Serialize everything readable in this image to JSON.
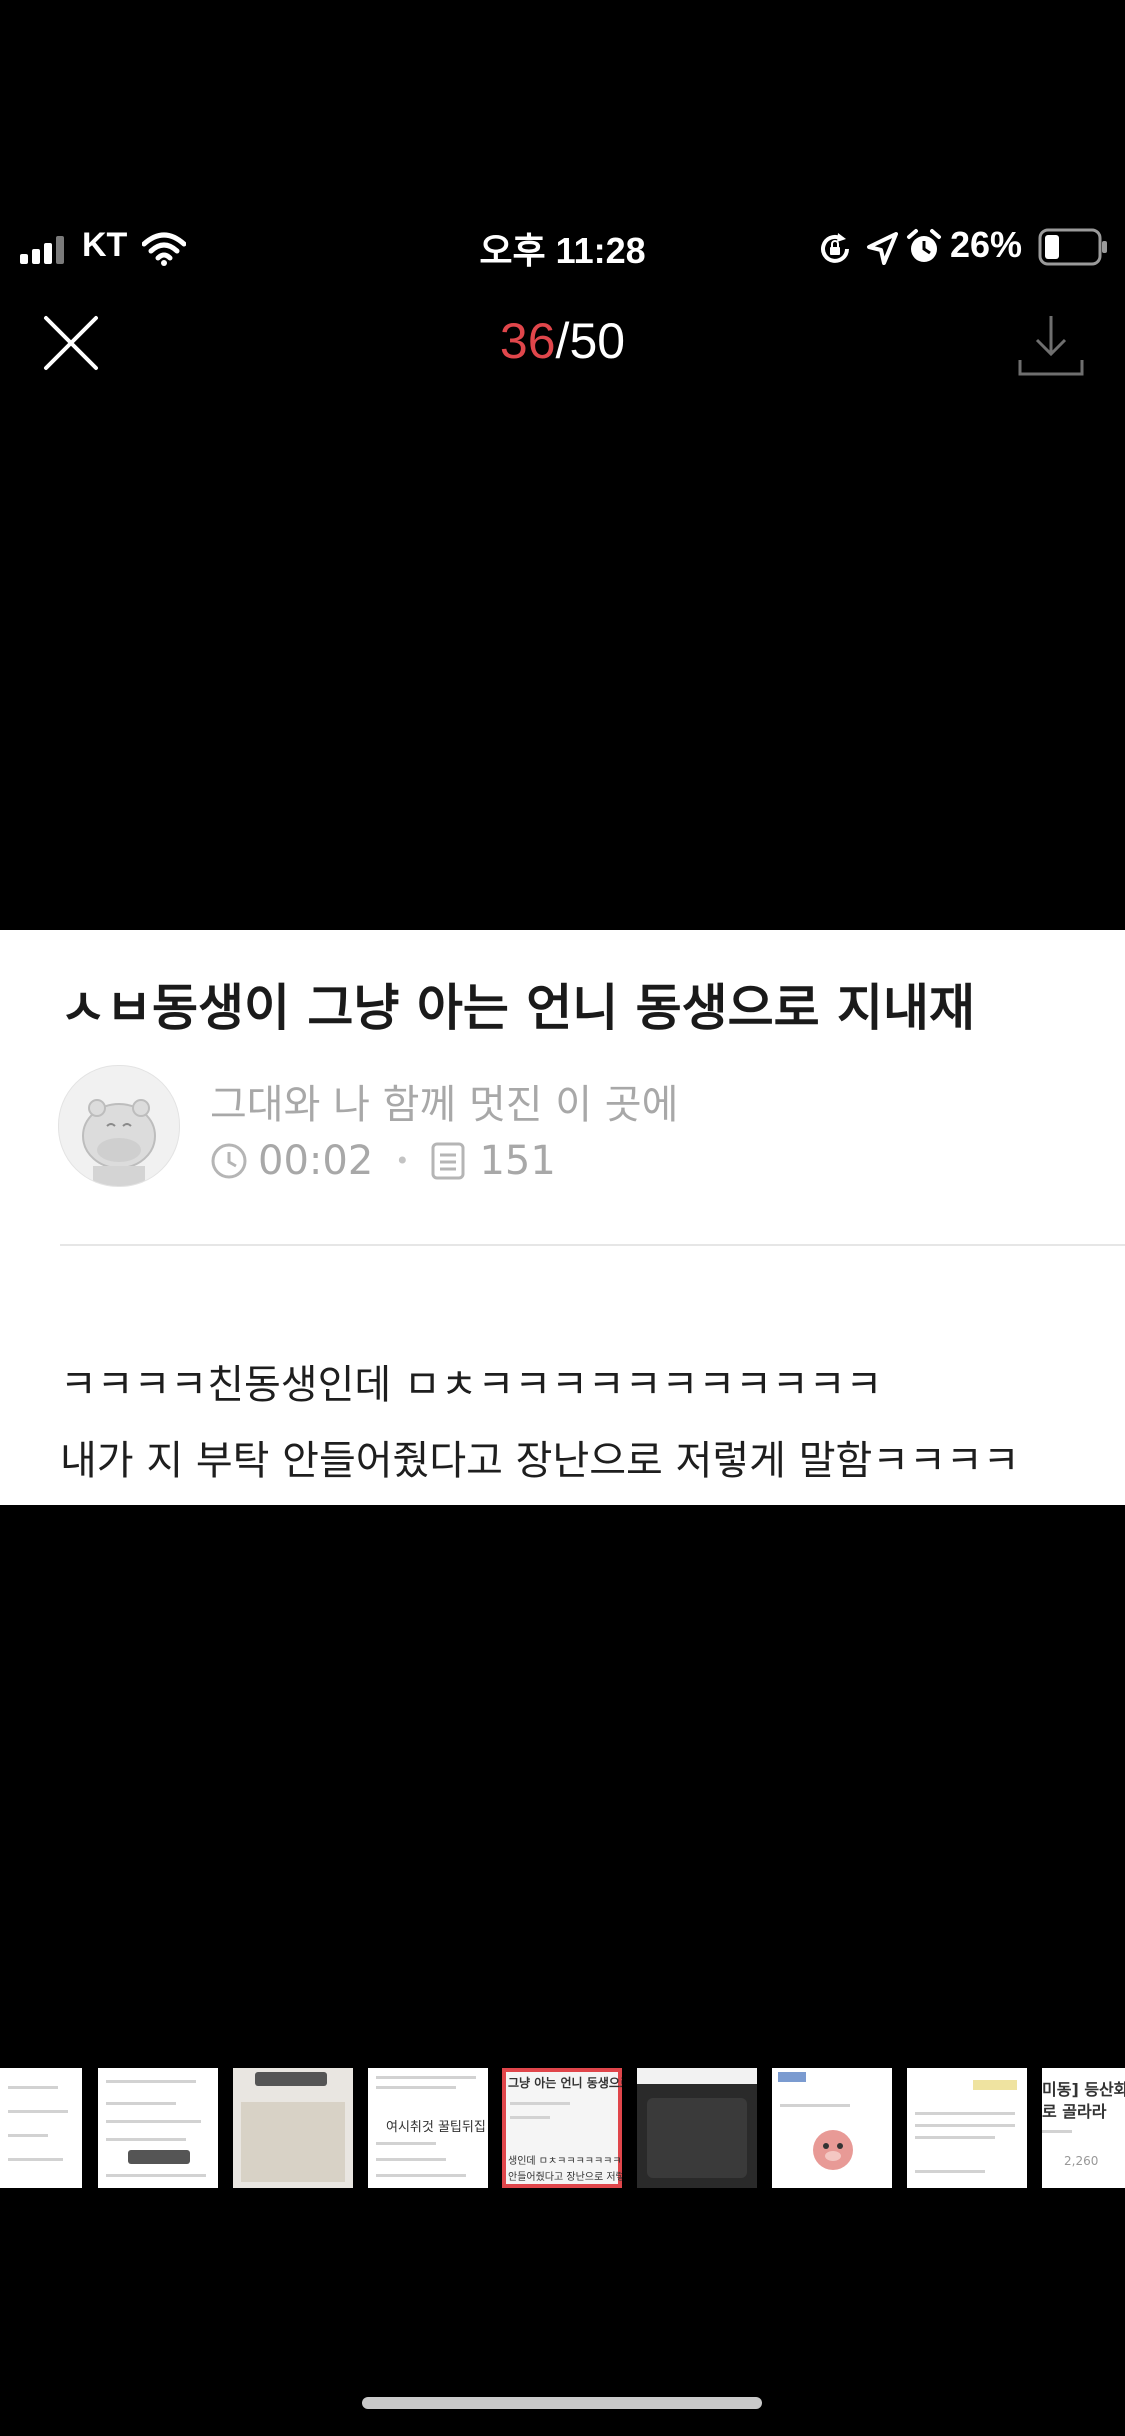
{
  "status_bar": {
    "carrier": "KT",
    "time": "오후 11:28",
    "battery": "26%"
  },
  "viewer": {
    "current": "36",
    "total": "/50",
    "close_icon": "close-icon",
    "download_icon": "download-icon",
    "accent": "#e0464b"
  },
  "post": {
    "title": "ㅅㅂ동생이 그냥 아는 언니 동생으로 지내재",
    "author": "그대와 나 함께 멋진 이 곳에",
    "time": "00:02",
    "views": "151",
    "body": [
      "ㅋㅋㅋㅋ친동생인데 ㅁㅊㅋㅋㅋㅋㅋㅋㅋㅋㅋㅋㅋ",
      "내가 지 부탁 안들어줬다고 장난으로 저렇게 말함ㅋㅋㅋㅋ"
    ]
  },
  "thumbnails": {
    "t4_label": "여시취것 꿀팁뒤집",
    "t5_title": "그냥 아는 언니 동생으로",
    "t5_line1": "생인데 ㅁㅊㅋㅋㅋㅋㅋㅋㅋㅋ",
    "t5_line2": "안들어줬다고 장난으로 저렇",
    "t9_line1": "미동] 등산화",
    "t9_line2": "로 골라라",
    "t9_views": "2,260"
  }
}
